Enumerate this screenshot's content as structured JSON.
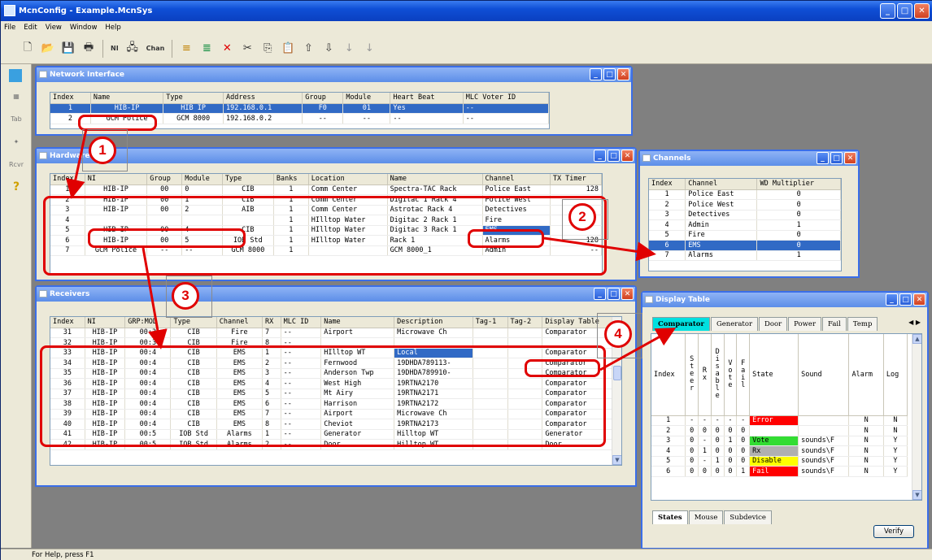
{
  "app": {
    "title": "McnConfig - Example.McnSys",
    "status": "For Help, press F1"
  },
  "menu": [
    "File",
    "Edit",
    "View",
    "Window",
    "Help"
  ],
  "toolbar": {
    "ni_label": "NI",
    "chan_label": "Chan"
  },
  "left_toolbar": [
    "Tab",
    "Rcvr"
  ],
  "network_interface": {
    "title": "Network Interface",
    "columns": [
      "Index",
      "Name",
      "Type",
      "Address",
      "Group",
      "Module",
      "Heart Beat",
      "MLC Voter ID"
    ],
    "rows": [
      [
        "1",
        "HIB-IP",
        "HIB IP",
        "192.168.0.1",
        "F0",
        "01",
        "Yes",
        "--"
      ],
      [
        "2",
        "GCM Police",
        "GCM 8000",
        "192.168.0.2",
        "--",
        "--",
        "--",
        "--"
      ]
    ]
  },
  "hardware": {
    "title": "Hardware",
    "columns": [
      "Index",
      "NI",
      "Group",
      "Module",
      "Type",
      "Banks",
      "Location",
      "Name",
      "Channel",
      "TX Timer"
    ],
    "rows": [
      [
        "1",
        "HIB-IP",
        "00",
        "0",
        "CIB",
        "1",
        "Comm Center",
        "Spectra-TAC Rack",
        "Police East",
        "128"
      ],
      [
        "2",
        "HIB-IP",
        "00",
        "1",
        "CIB",
        "1",
        "Comm Center",
        "Digitac 1 Rack 4",
        "Police West",
        ""
      ],
      [
        "3",
        "HIB-IP",
        "00",
        "2",
        "AIB",
        "1",
        "Comm Center",
        "Astrotac Rack 4",
        "Detectives",
        ""
      ],
      [
        "4",
        "",
        "",
        "",
        "",
        "1",
        "HIlltop Water",
        "Digitac 2  Rack 1",
        "Fire",
        ""
      ],
      [
        "5",
        "HIB-IP",
        "00",
        "4",
        "CIB",
        "1",
        "HIlltop Water",
        "Digitac 3  Rack 1",
        "EMS",
        ""
      ],
      [
        "6",
        "HIB-IP",
        "00",
        "5",
        "IOB Std",
        "1",
        "HIlltop Water",
        "Rack 1",
        "Alarms",
        "128"
      ],
      [
        "7",
        "GCM Police",
        "--",
        "--",
        "GCM 8000",
        "1",
        "",
        "GCM 8000_1",
        "Admin",
        "--"
      ]
    ]
  },
  "channels": {
    "title": "Channels",
    "columns": [
      "Index",
      "Channel",
      "WD Multiplier"
    ],
    "rows": [
      [
        "1",
        "Police East",
        "0"
      ],
      [
        "2",
        "Police West",
        "0"
      ],
      [
        "3",
        "Detectives",
        "0"
      ],
      [
        "4",
        "Admin",
        "1"
      ],
      [
        "5",
        "Fire",
        "0"
      ],
      [
        "6",
        "EMS",
        "0"
      ],
      [
        "7",
        "Alarms",
        "1"
      ]
    ]
  },
  "receivers": {
    "title": "Receivers",
    "columns": [
      "Index",
      "NI",
      "GRP:MOD",
      "Type",
      "Channel",
      "RX",
      "MLC ID",
      "Name",
      "Description",
      "Tag-1",
      "Tag-2",
      "Display Table"
    ],
    "rows": [
      [
        "31",
        "HIB-IP",
        "00:3",
        "CIB",
        "Fire",
        "7",
        "--",
        "Airport",
        "Microwave Ch",
        "",
        "",
        "Comparator"
      ],
      [
        "32",
        "HIB-IP",
        "00:3",
        "CIB",
        "Fire",
        "8",
        "--",
        "",
        "",
        "",
        "",
        ""
      ],
      [
        "33",
        "HIB-IP",
        "00:4",
        "CIB",
        "EMS",
        "1",
        "--",
        "HIlltop WT",
        "Local",
        "",
        "",
        "Comparator"
      ],
      [
        "34",
        "HIB-IP",
        "00:4",
        "CIB",
        "EMS",
        "2",
        "--",
        "Fernwood",
        "19DHDA789113-",
        "",
        "",
        "Comparator"
      ],
      [
        "35",
        "HIB-IP",
        "00:4",
        "CIB",
        "EMS",
        "3",
        "--",
        "Anderson Twp",
        "19DHDA789910-",
        "",
        "",
        "Comparator"
      ],
      [
        "36",
        "HIB-IP",
        "00:4",
        "CIB",
        "EMS",
        "4",
        "--",
        "West High",
        "19RTNA2170",
        "",
        "",
        "Comparator"
      ],
      [
        "37",
        "HIB-IP",
        "00:4",
        "CIB",
        "EMS",
        "5",
        "--",
        "Mt Airy",
        "19RTNA2171",
        "",
        "",
        "Comparator"
      ],
      [
        "38",
        "HIB-IP",
        "00:4",
        "CIB",
        "EMS",
        "6",
        "--",
        "Harrison",
        "19RTNA2172",
        "",
        "",
        "Comparator"
      ],
      [
        "39",
        "HIB-IP",
        "00:4",
        "CIB",
        "EMS",
        "7",
        "--",
        "Airport",
        "Microwave Ch",
        "",
        "",
        "Comparator"
      ],
      [
        "40",
        "HIB-IP",
        "00:4",
        "CIB",
        "EMS",
        "8",
        "--",
        "Cheviot",
        "19RTNA2173",
        "",
        "",
        "Comparator"
      ],
      [
        "41",
        "HIB-IP",
        "00:5",
        "IOB Std",
        "Alarms",
        "1",
        "--",
        "Generator",
        "Hilltop WT",
        "",
        "",
        "Generator"
      ],
      [
        "42",
        "HIB-IP",
        "00:5",
        "IOB Std",
        "Alarms",
        "2",
        "--",
        "Door",
        "Hilltop WT",
        "",
        "",
        "Door"
      ]
    ]
  },
  "display_table": {
    "title": "Display Table",
    "tabs": [
      "Comparator",
      "Generator",
      "Door",
      "Power",
      "Fail",
      "Temp"
    ],
    "headers": {
      "index": "Index",
      "steer": "Steer",
      "rx": "Rx",
      "disable": "Disable",
      "vote": "Vote",
      "fail": "Fail",
      "state": "State",
      "sound": "Sound",
      "alarm": "Alarm",
      "log": "Log"
    },
    "rows": [
      {
        "index": "1",
        "s": "-",
        "r": "-",
        "d": "-",
        "v": "-",
        "f": "-",
        "state": "Error",
        "sound": "",
        "alarm": "N",
        "log": "N",
        "color": "#ff0000"
      },
      {
        "index": "2",
        "s": "0",
        "r": "0",
        "d": "0",
        "v": "0",
        "f": "0",
        "state": "",
        "sound": "",
        "alarm": "N",
        "log": "N",
        "color": ""
      },
      {
        "index": "3",
        "s": "0",
        "r": "-",
        "d": "0",
        "v": "1",
        "f": "0",
        "state": "Vote",
        "sound": "sounds\\F",
        "alarm": "N",
        "log": "Y",
        "color": "#33dd33"
      },
      {
        "index": "4",
        "s": "0",
        "r": "1",
        "d": "0",
        "v": "0",
        "f": "0",
        "state": "Rx",
        "sound": "sounds\\F",
        "alarm": "N",
        "log": "Y",
        "color": "#b0b0b0"
      },
      {
        "index": "5",
        "s": "0",
        "r": "-",
        "d": "1",
        "v": "0",
        "f": "0",
        "state": "Disable",
        "sound": "sounds\\F",
        "alarm": "N",
        "log": "Y",
        "color": "#ffff00"
      },
      {
        "index": "6",
        "s": "0",
        "r": "0",
        "d": "0",
        "v": "0",
        "f": "1",
        "state": "Fail",
        "sound": "sounds\\F",
        "alarm": "N",
        "log": "Y",
        "color": "#ff0000"
      }
    ],
    "bottom_tabs": [
      "States",
      "Mouse",
      "Subdevice"
    ],
    "verify_label": "Verify"
  },
  "callouts": [
    "1",
    "2",
    "3",
    "4"
  ],
  "colors": {
    "annotation": "#e00000",
    "selection": "#316ac5",
    "titlebar": "#0f4fd6"
  }
}
